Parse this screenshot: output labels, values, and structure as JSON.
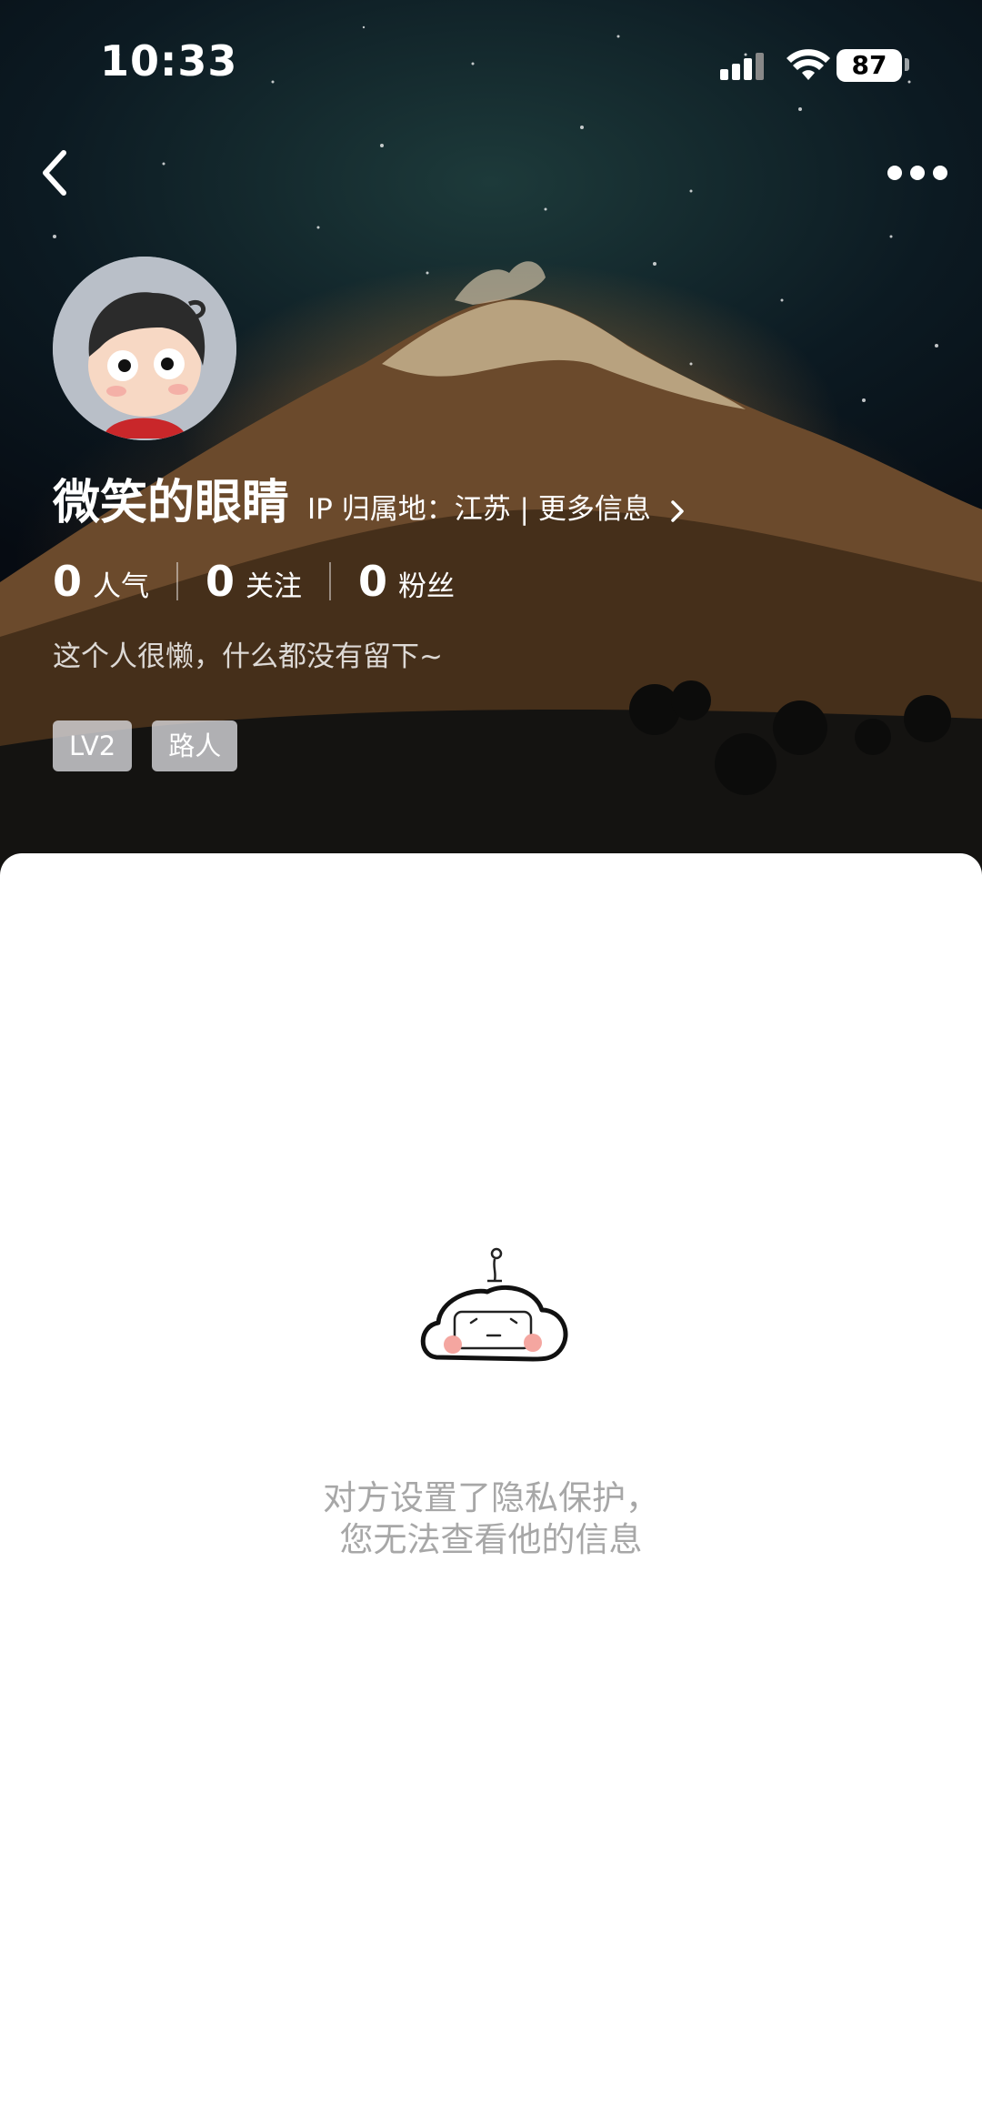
{
  "status_bar": {
    "time": "10:33",
    "battery": "87",
    "icons": [
      "cellular-signal-icon",
      "wifi-icon",
      "battery-icon"
    ]
  },
  "nav": {
    "back_icon": "chevron-left-icon",
    "more_icon": "more-horizontal-icon"
  },
  "profile": {
    "username": "微笑的眼睛",
    "ip_location": "IP 归属地：江苏 | 更多信息",
    "stats": [
      {
        "value": "0",
        "label": "人气"
      },
      {
        "value": "0",
        "label": "关注"
      },
      {
        "value": "0",
        "label": "粉丝"
      }
    ],
    "bio": "这个人很懒，什么都没有留下~",
    "tags": [
      "LV2",
      "路人"
    ]
  },
  "content": {
    "privacy_line1": "对方设置了隐私保护，",
    "privacy_line2": "您无法查看他的信息"
  },
  "colors": {
    "hint_text": "#a7a7a7",
    "tag_bg": "#d8d8dc"
  }
}
